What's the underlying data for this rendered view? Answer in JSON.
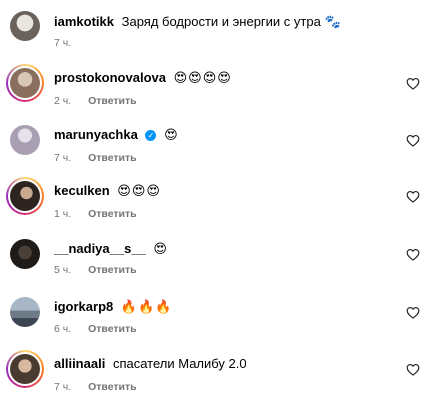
{
  "post": {
    "username": "iamkotikk",
    "caption": "Заряд бодрости и энергии с утра",
    "caption_emoji": "🐾",
    "time": "7 ч."
  },
  "comments": [
    {
      "username": "prostokonovalova",
      "text": "",
      "emoji": "😍😍😍😍",
      "time": "2 ч.",
      "reply": "Ответить",
      "avatar_color": "#c9b8a8"
    },
    {
      "username": "marunyachka",
      "verified_icon": "verified-badge",
      "text": "",
      "emoji": "😍",
      "time": "7 ч.",
      "reply": "Ответить",
      "avatar_color": "#b9b4c4"
    },
    {
      "username": "keculken",
      "text": "",
      "emoji": "😍😍😍",
      "time": "1 ч.",
      "reply": "Ответить",
      "avatar_color": "#3b302a"
    },
    {
      "username": "__nadiya__s__",
      "text": "",
      "emoji": "😍",
      "time": "5 ч.",
      "reply": "Ответить",
      "avatar_color": "#2a2a2a"
    },
    {
      "username": "igorkarp8",
      "text": "",
      "emoji": "🔥🔥🔥",
      "time": "6 ч.",
      "reply": "Ответить",
      "avatar_color": "#8fa0b4"
    },
    {
      "username": "alliinaali",
      "text": "спасатели Малибу 2.0",
      "emoji": "",
      "time": "7 ч.",
      "reply": "Ответить",
      "avatar_color": "#5a4a3c"
    }
  ],
  "icons": {
    "like": "heart-outline-icon",
    "verified": "verified-badge"
  }
}
